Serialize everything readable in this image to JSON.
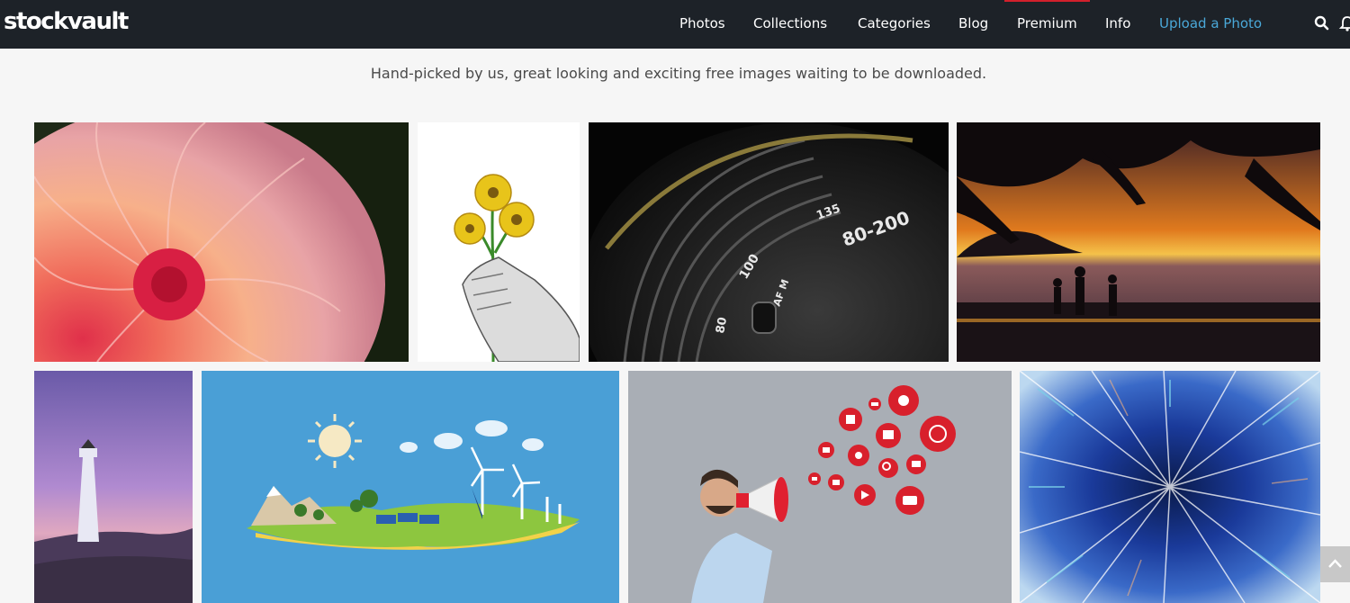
{
  "header": {
    "logo_text": "stockvault",
    "nav": [
      {
        "label": "Photos"
      },
      {
        "label": "Collections"
      },
      {
        "label": "Categories"
      },
      {
        "label": "Blog"
      },
      {
        "label": "Premium"
      },
      {
        "label": "Info"
      },
      {
        "label": "Upload a Photo"
      }
    ],
    "icons": [
      "search-icon",
      "bell-icon"
    ]
  },
  "main": {
    "tagline": "Hand-picked by us, great looking and exciting free images waiting to be downloaded."
  },
  "gallery": {
    "photos": [
      {
        "subject": "dahlia-flower",
        "lens_text": ""
      },
      {
        "subject": "hand-holding-flowers"
      },
      {
        "subject": "camera-lens",
        "lens_text": "80-200",
        "lens_marks": [
          "135",
          "100",
          "80"
        ],
        "af_label": "AF M"
      },
      {
        "subject": "beach-sunset"
      },
      {
        "subject": "lighthouse"
      },
      {
        "subject": "wind-turbines-illustration"
      },
      {
        "subject": "man-with-megaphone"
      },
      {
        "subject": "blue-burst-abstract"
      }
    ]
  },
  "colors": {
    "header_bg": "#1d2228",
    "upload_link": "#4aa8d8",
    "premium_accent": "#d2202c",
    "page_bg": "#f6f6f6"
  }
}
